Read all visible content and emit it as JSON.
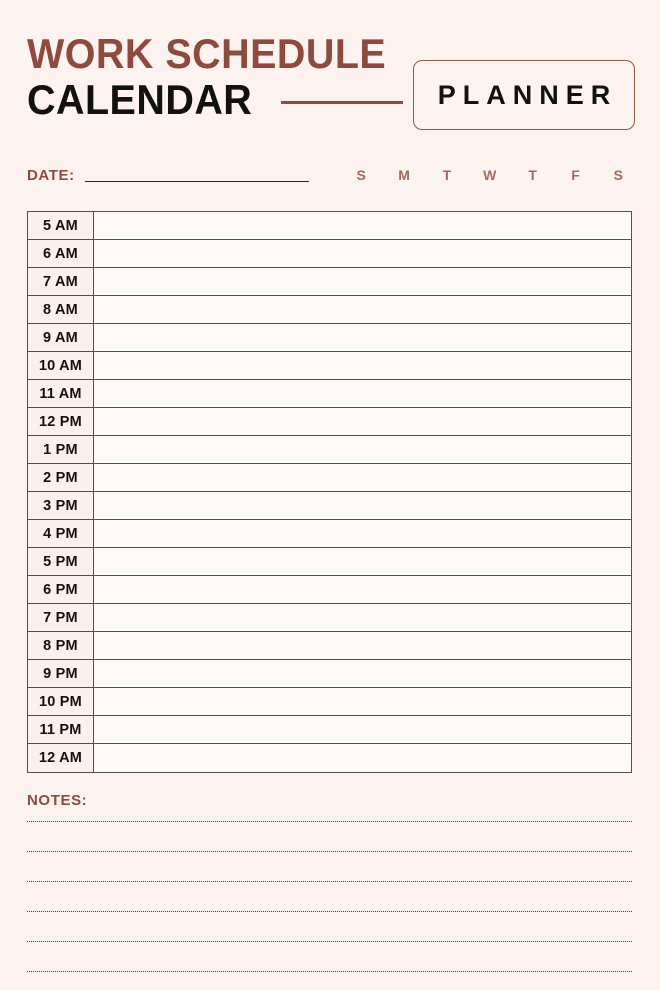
{
  "document": {
    "background_color": "#fcf3f0",
    "accent_color": "#8c4b3e",
    "ink_color": "#111111"
  },
  "header": {
    "title_line1": "WORK SCHEDULE",
    "title_line2": "CALENDAR",
    "badge_label": "PLANNER"
  },
  "meta": {
    "date_label": "DATE:",
    "date_value": "",
    "weekdays": [
      "S",
      "M",
      "T",
      "W",
      "T",
      "F",
      "S"
    ]
  },
  "schedule": {
    "rows": [
      {
        "time": "5 AM",
        "entry": ""
      },
      {
        "time": "6 AM",
        "entry": ""
      },
      {
        "time": "7 AM",
        "entry": ""
      },
      {
        "time": "8 AM",
        "entry": ""
      },
      {
        "time": "9 AM",
        "entry": ""
      },
      {
        "time": "10 AM",
        "entry": ""
      },
      {
        "time": "11 AM",
        "entry": ""
      },
      {
        "time": "12 PM",
        "entry": ""
      },
      {
        "time": "1 PM",
        "entry": ""
      },
      {
        "time": "2 PM",
        "entry": ""
      },
      {
        "time": "3 PM",
        "entry": ""
      },
      {
        "time": "4 PM",
        "entry": ""
      },
      {
        "time": "5 PM",
        "entry": ""
      },
      {
        "time": "6 PM",
        "entry": ""
      },
      {
        "time": "7 PM",
        "entry": ""
      },
      {
        "time": "8 PM",
        "entry": ""
      },
      {
        "time": "9 PM",
        "entry": ""
      },
      {
        "time": "10 PM",
        "entry": ""
      },
      {
        "time": "11 PM",
        "entry": ""
      },
      {
        "time": "12 AM",
        "entry": ""
      }
    ]
  },
  "notes": {
    "label": "NOTES:",
    "lines": [
      "",
      "",
      "",
      "",
      "",
      ""
    ]
  }
}
